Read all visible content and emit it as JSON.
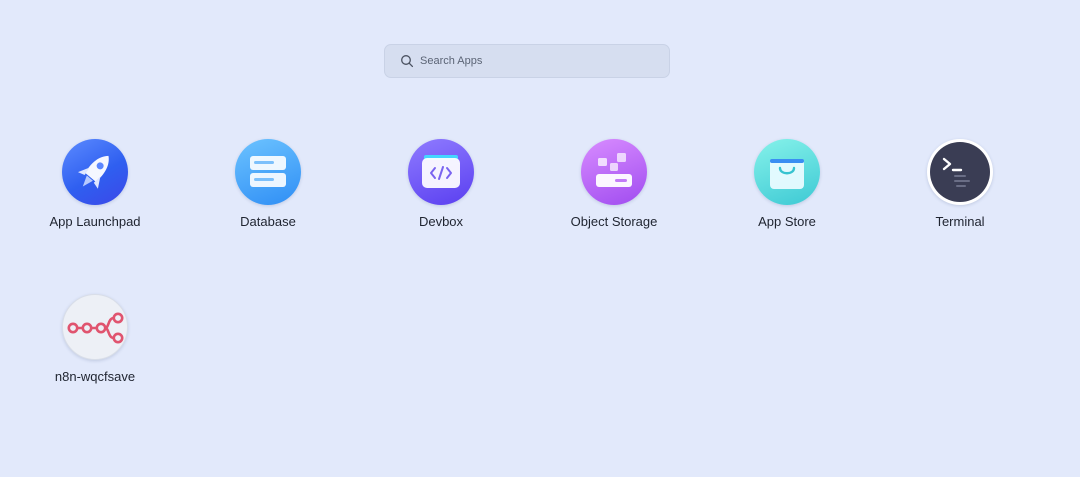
{
  "search": {
    "placeholder": "Search Apps",
    "icon": "search-icon"
  },
  "apps": [
    {
      "label": "App Launchpad",
      "icon": "rocket-icon"
    },
    {
      "label": "Database",
      "icon": "database-icon"
    },
    {
      "label": "Devbox",
      "icon": "code-folder-icon"
    },
    {
      "label": "Object Storage",
      "icon": "object-storage-icon"
    },
    {
      "label": "App Store",
      "icon": "shopping-bag-icon"
    },
    {
      "label": "Terminal",
      "icon": "terminal-icon"
    },
    {
      "label": "n8n-wqcfsave",
      "icon": "n8n-workflow-icon"
    }
  ],
  "colors": {
    "background": "#e2e9fb",
    "search_bg": "#d6def0",
    "launchpad": "#2f5ff0",
    "database": "#2f8ef5",
    "devbox": "#5a3ff0",
    "object_storage": "#a04cf0",
    "app_store": "#3dc9d4",
    "terminal": "#3a3d54",
    "n8n": "#e0546f"
  }
}
